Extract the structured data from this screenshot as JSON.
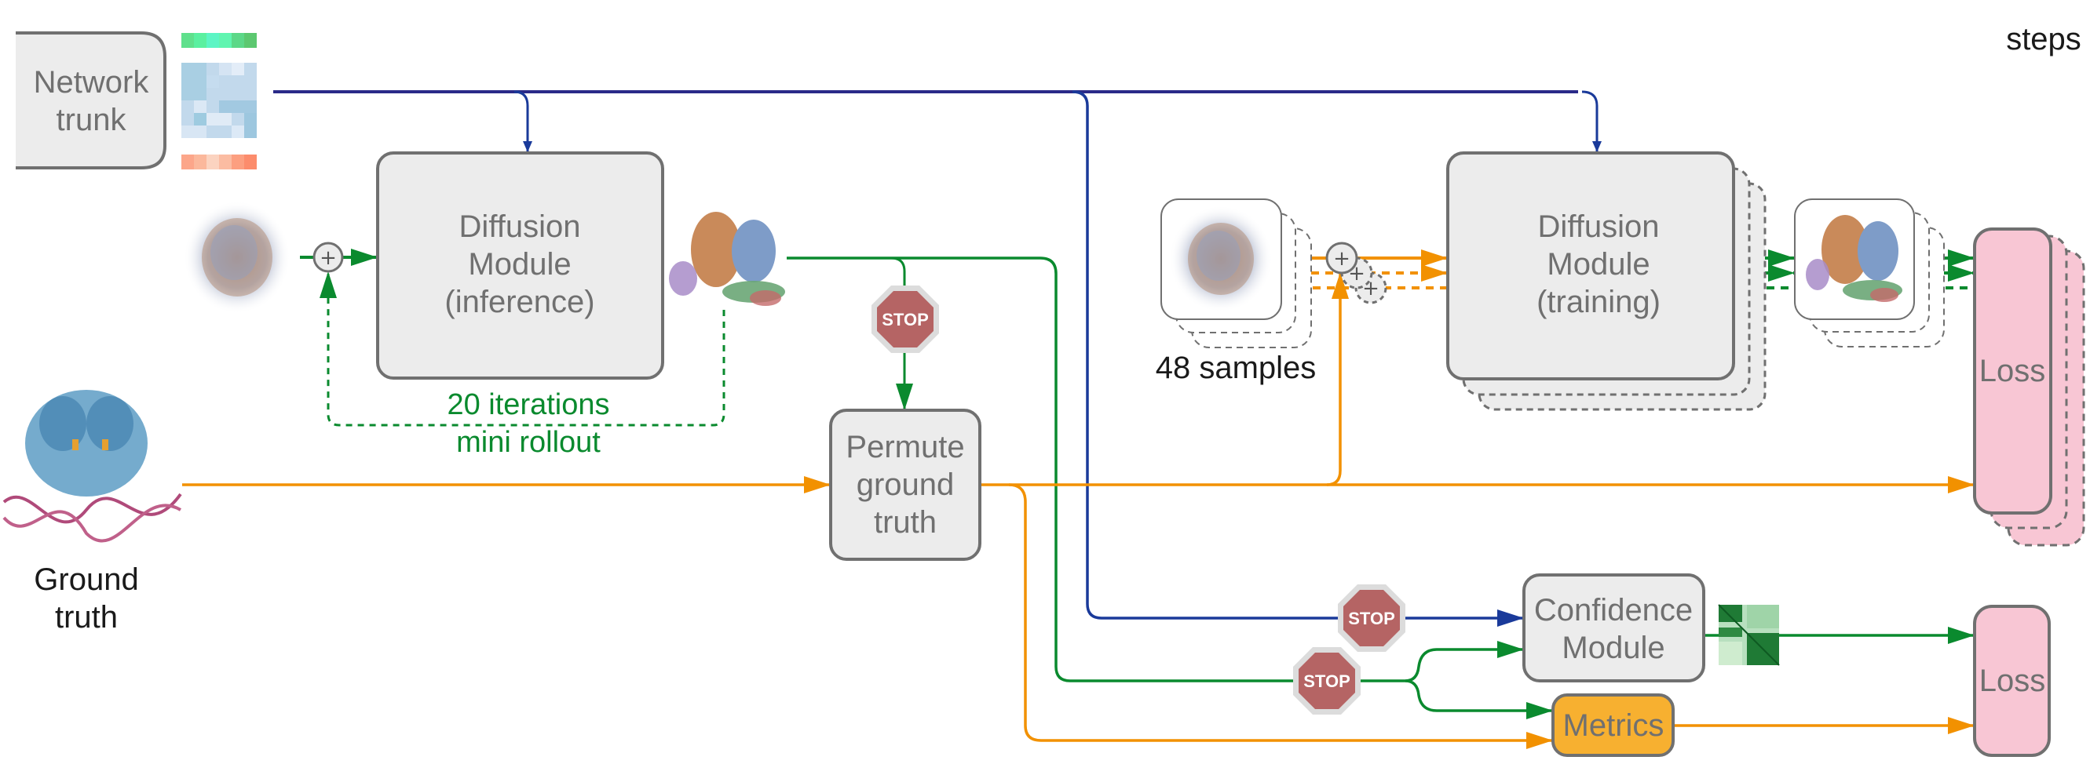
{
  "header": {
    "steps_label": "steps"
  },
  "nodes": {
    "network_trunk": {
      "line1": "Network",
      "line2": "trunk"
    },
    "diffusion_inference": {
      "line1": "Diffusion",
      "line2": "Module",
      "line3": "(inference)"
    },
    "permute": {
      "line1": "Permute",
      "line2": "ground",
      "line3": "truth"
    },
    "diffusion_training": {
      "line1": "Diffusion",
      "line2": "Module",
      "line3": "(training)"
    },
    "confidence": {
      "line1": "Confidence",
      "line2": "Module"
    },
    "metrics": {
      "label": "Metrics"
    },
    "loss_main": {
      "label": "Loss"
    },
    "loss_aux": {
      "label": "Loss"
    }
  },
  "annotations": {
    "rollout_line1": "20 iterations",
    "rollout_line2": "mini rollout",
    "samples": "48 samples",
    "ground_truth_line1": "Ground",
    "ground_truth_line2": "truth",
    "stop": "STOP"
  },
  "icons": {
    "plus": "+",
    "noise_cloud": "noise-point-cloud",
    "predicted_structure": "predicted-structure",
    "ground_truth_structure": "protein-dna-structure",
    "confidence_heatmap": "pae-heatmap"
  },
  "colors": {
    "trunk_blue": "#1a3a9a",
    "green": "#0a8a2e",
    "orange": "#f29100",
    "box_fill": "#ececec",
    "box_stroke": "#707070",
    "loss_fill": "#f8c6d4",
    "metrics_fill": "#f7b030",
    "stop_fill": "#b56464"
  }
}
